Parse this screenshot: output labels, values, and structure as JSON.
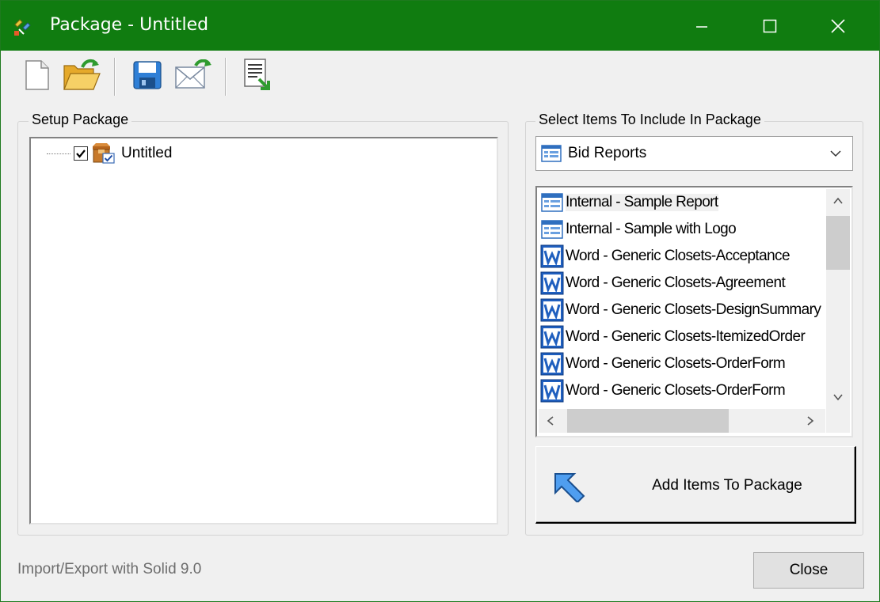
{
  "window": {
    "title": "Package - Untitled",
    "accent_color": "#107c10",
    "controls": [
      "minimize-icon",
      "maximize-icon",
      "close-icon"
    ]
  },
  "toolbar": {
    "buttons": [
      {
        "name": "new-document",
        "icon": "new-document-icon"
      },
      {
        "name": "open-folder",
        "icon": "open-folder-icon"
      },
      {
        "name": "save",
        "icon": "save-disk-icon"
      },
      {
        "name": "email",
        "icon": "email-envelope-icon"
      },
      {
        "name": "export",
        "icon": "export-document-icon"
      }
    ]
  },
  "setup_package": {
    "legend": "Setup Package",
    "tree": [
      {
        "label": "Untitled",
        "checked": true,
        "icon": "package-icon"
      }
    ]
  },
  "select_items": {
    "legend": "Select Items To Include In Package",
    "combo": {
      "selected": "Bid Reports",
      "icon": "report-icon"
    },
    "list": [
      {
        "label": "Internal - Sample Report",
        "icon": "report-icon",
        "selected": true
      },
      {
        "label": "Internal - Sample with Logo",
        "icon": "report-icon"
      },
      {
        "label": "Word - Generic Closets-Acceptance",
        "icon": "word-doc-icon"
      },
      {
        "label": "Word - Generic Closets-Agreement",
        "icon": "word-doc-icon"
      },
      {
        "label": "Word - Generic Closets-DesignSummary",
        "icon": "word-doc-icon"
      },
      {
        "label": "Word - Generic Closets-ItemizedOrder",
        "icon": "word-doc-icon"
      },
      {
        "label": "Word - Generic Closets-OrderForm",
        "icon": "word-doc-icon"
      },
      {
        "label": "Word - Generic Closets-OrderForm",
        "icon": "word-doc-icon"
      }
    ],
    "add_button": {
      "label": "Add Items To Package",
      "icon": "arrow-up-left-icon"
    }
  },
  "footer": {
    "status": "Import/Export with Solid 9.0",
    "close_label": "Close"
  }
}
